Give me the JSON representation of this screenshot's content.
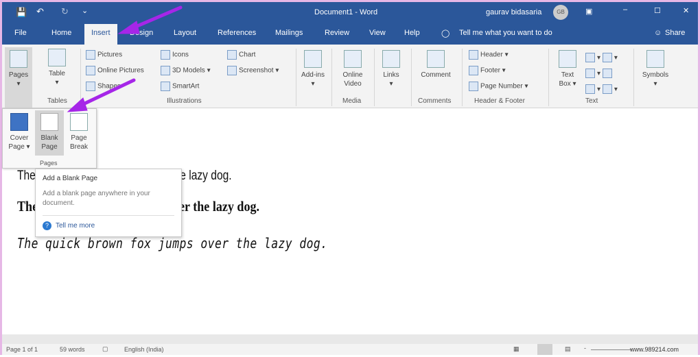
{
  "title": {
    "document": "Document1 - Word",
    "user": "gaurav bidasaria",
    "user_initials": "GB"
  },
  "tabs": [
    "File",
    "Home",
    "Insert",
    "Design",
    "Layout",
    "References",
    "Mailings",
    "Review",
    "View",
    "Help"
  ],
  "active_tab": "Insert",
  "tell_me": "Tell me what you want to do",
  "share": "Share",
  "ribbon": {
    "pages": "Pages",
    "table": "Table",
    "tables_group": "Tables",
    "pictures": "Pictures",
    "online_pictures": "Online Pictures",
    "shapes": "Shapes",
    "icons": "Icons",
    "models": "3D Models",
    "smartart": "SmartArt",
    "chart": "Chart",
    "screenshot": "Screenshot",
    "illustrations_group": "Illustrations",
    "addins": "Add-ins",
    "online_video": "Online Video",
    "media_group": "Media",
    "links": "Links",
    "comment": "Comment",
    "comments_group": "Comments",
    "header": "Header",
    "footer": "Footer",
    "page_number": "Page Number",
    "hf_group": "Header & Footer",
    "text_box": "Text Box",
    "text_group": "Text",
    "symbols": "Symbols"
  },
  "pages_panel": {
    "cover_page": "Cover Page",
    "blank_page": "Blank Page",
    "page_break": "Page Break",
    "group": "Pages"
  },
  "tooltip": {
    "title": "Add a Blank Page",
    "body": "Add a blank page anywhere in your document.",
    "link": "Tell me more"
  },
  "document": {
    "lines": [
      "The quick brown fox jumps over the lazy dog.",
      "The quick brown fox jumps over the lazy dog.",
      "The quick brown fox jumps over the lazy dog."
    ]
  },
  "status": {
    "page": "Page 1 of 1",
    "words": "59 words",
    "language": "English (India)",
    "watermark": "www.989214.com"
  },
  "colors": {
    "accent": "#2b579a",
    "arrow": "#a626e8"
  }
}
